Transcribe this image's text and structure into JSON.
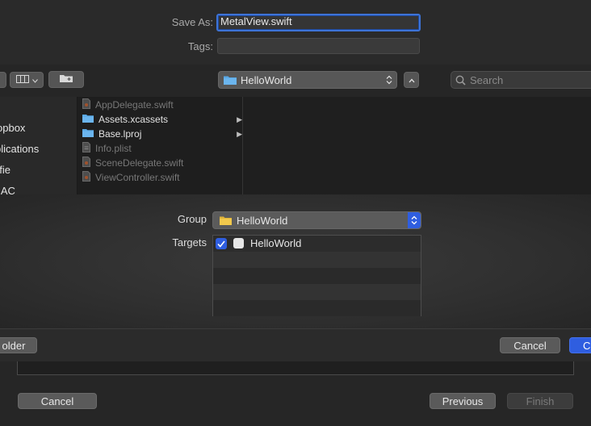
{
  "save": {
    "save_as_label": "Save As:",
    "save_as_value": "MetalView.swift",
    "tags_label": "Tags:",
    "tags_value": ""
  },
  "toolbar": {
    "location_popup": "HelloWorld",
    "search_placeholder": "Search"
  },
  "sidebar": {
    "items": [
      "opbox",
      "plications",
      "ofie",
      "MAC"
    ]
  },
  "files": [
    {
      "name": "AppDelegate.swift",
      "type": "swift",
      "enabled": false,
      "has_children": false
    },
    {
      "name": "Assets.xcassets",
      "type": "folder",
      "enabled": true,
      "has_children": true
    },
    {
      "name": "Base.lproj",
      "type": "folder",
      "enabled": true,
      "has_children": true
    },
    {
      "name": "Info.plist",
      "type": "plist",
      "enabled": false,
      "has_children": false
    },
    {
      "name": "SceneDelegate.swift",
      "type": "swift",
      "enabled": false,
      "has_children": false
    },
    {
      "name": "ViewController.swift",
      "type": "swift",
      "enabled": false,
      "has_children": false
    }
  ],
  "options": {
    "group_label": "Group",
    "group_value": "HelloWorld",
    "targets_label": "Targets",
    "targets": [
      {
        "name": "HelloWorld",
        "checked": true
      }
    ]
  },
  "buttons": {
    "new_folder": "older",
    "cancel": "Cancel",
    "create": "C"
  },
  "underlying": {
    "cancel": "Cancel",
    "previous": "Previous",
    "finish": "Finish"
  },
  "colors": {
    "accent": "#2f5ee0",
    "folder": "#5aa9e6"
  }
}
